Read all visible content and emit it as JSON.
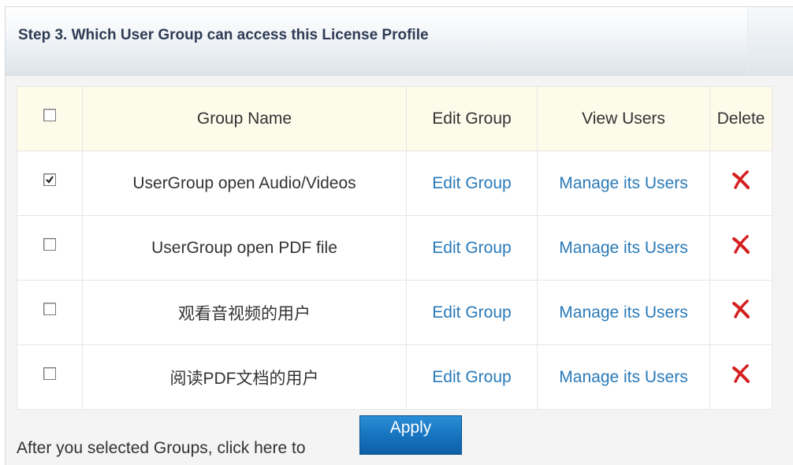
{
  "panel": {
    "title": "Step 3. Which User Group can access this License Profile"
  },
  "table": {
    "headers": {
      "group_name": "Group Name",
      "edit_group": "Edit Group",
      "view_users": "View Users",
      "delete": "Delete"
    },
    "header_checked": false,
    "rows": [
      {
        "checked": true,
        "name": "UserGroup open Audio/Videos",
        "edit": "Edit Group",
        "manage": "Manage its Users"
      },
      {
        "checked": false,
        "name": "UserGroup open PDF file",
        "edit": "Edit Group",
        "manage": "Manage its Users"
      },
      {
        "checked": false,
        "name": "观看音视频的用户",
        "edit": "Edit Group",
        "manage": "Manage its Users"
      },
      {
        "checked": false,
        "name": "阅读PDF文档的用户",
        "edit": "Edit Group",
        "manage": "Manage its Users"
      }
    ]
  },
  "footer": {
    "instruction": "After you selected Groups, click here to",
    "apply_label": "Apply"
  },
  "icons": {
    "checkbox": "checkbox-icon",
    "delete": "red-x-delete-icon"
  },
  "colors": {
    "link": "#2a7ab8",
    "header_row_bg": "#fdfbea",
    "delete_icon": "#d42020",
    "apply_button": "#1672bd",
    "title_text": "#2f3c55"
  }
}
